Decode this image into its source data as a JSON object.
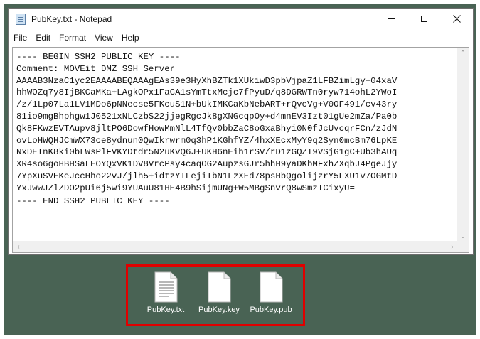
{
  "window": {
    "title": "PubKey.txt - Notepad",
    "minimize_icon": "minimize-icon",
    "maximize_icon": "maximize-icon",
    "close_icon": "close-icon"
  },
  "menu": {
    "items": [
      "File",
      "Edit",
      "Format",
      "View",
      "Help"
    ]
  },
  "editor": {
    "lines": [
      "---- BEGIN SSH2 PUBLIC KEY ----",
      "Comment: MOVEit DMZ SSH Server",
      "AAAAB3NzaC1yc2EAAAABEQAAAgEAs39e3HyXhBZTk1XUkiwD3pbVjpaZ1LFBZimLgy+04xaV",
      "hhWOZq7y8IjBKCaMKa+LAgkOPx1FaCA1sYmTtxMcjc7fPyuD/q8DGRWTn0ryw714ohL2YWoI",
      "/z/1Lp07La1LV1MDo6pNNecse5FKcuS1N+bUkIMKCaKbNebART+rQvcVg+V0OF491/cv43ry",
      "81io9mgBhphgw1J0521xNLCzbS22jjegRgcJk8gXNGcqpOy+d4mnEV3Izt01gUe2mZa/Pa0b",
      "Qk8FKwzEVTAupv8jltPO6DowfHowMmNlL4TfQv0bbZaC8oGxaBhyi0N0fJcUvcqrFCn/zJdN",
      "ovLoHWQHJCmWX73ce8ydnun0QwIkrwrm0q3hP1KGhfYZ/4hxXEcxMyY9q2Syn0mcBm76LpKE",
      "NxDEInK8ki0bLWsPlFVKYDtdr5N2uKvQ6J+UKH6nEih1rSV/rD1zGQZT9VSjG1gC+Ub3hAUq",
      "XR4so6goHBHSaLEOYQxVK1DV8VrcPsy4caqOG2AupzsGJr5hhH9yaDKbMFxhZXqbJ4PgeJjy",
      "7YpXuSVEKeJccHho22vJ/jlh5+idtzYTFejiIbN1FzXEd78psHbQgolijzrY5FXU1v7OGMtD",
      "YxJwwJZlZDO2pUi6j5wi9YUAuU81HE4B9hSijmUNg+W5MBgSnvrQ8wSmzTCixyU=",
      "---- END SSH2 PUBLIC KEY ----"
    ]
  },
  "files": [
    {
      "label": "PubKey.txt",
      "icon": "text-file-icon"
    },
    {
      "label": "PubKey.key",
      "icon": "file-icon"
    },
    {
      "label": "PubKey.pub",
      "icon": "file-icon"
    }
  ],
  "colors": {
    "desktop": "#496354",
    "highlight_border": "#e00000"
  }
}
